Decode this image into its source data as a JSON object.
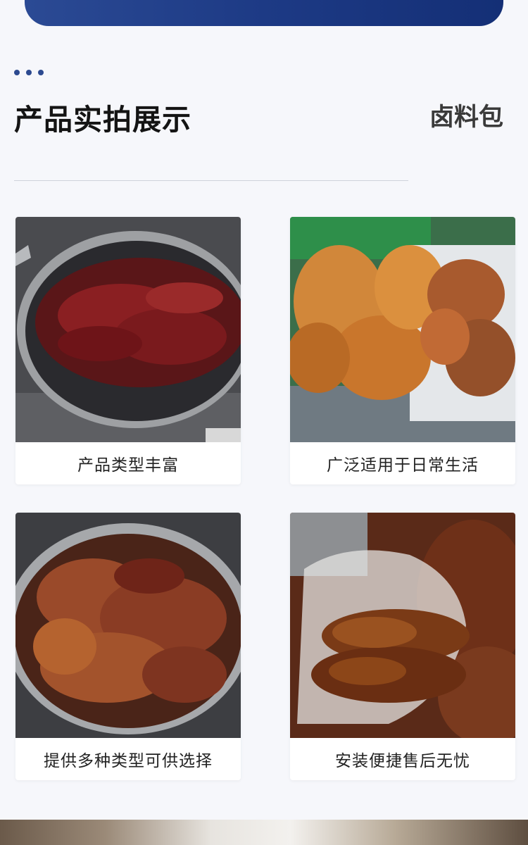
{
  "section": {
    "title": "产品实拍展示",
    "tag": "卤料包"
  },
  "cards": [
    {
      "caption": "产品类型丰富",
      "photo_icon": "chili-oil-pot-photo"
    },
    {
      "caption": "广泛适用于日常生活",
      "photo_icon": "braised-meat-tray-photo"
    },
    {
      "caption": "提供多种类型可供选择",
      "photo_icon": "braised-duck-pot-photo"
    },
    {
      "caption": "安装便捷售后无忧",
      "photo_icon": "braised-duck-head-photo"
    }
  ],
  "colors": {
    "accent": "#1d3a85",
    "background": "#f6f7fb"
  }
}
